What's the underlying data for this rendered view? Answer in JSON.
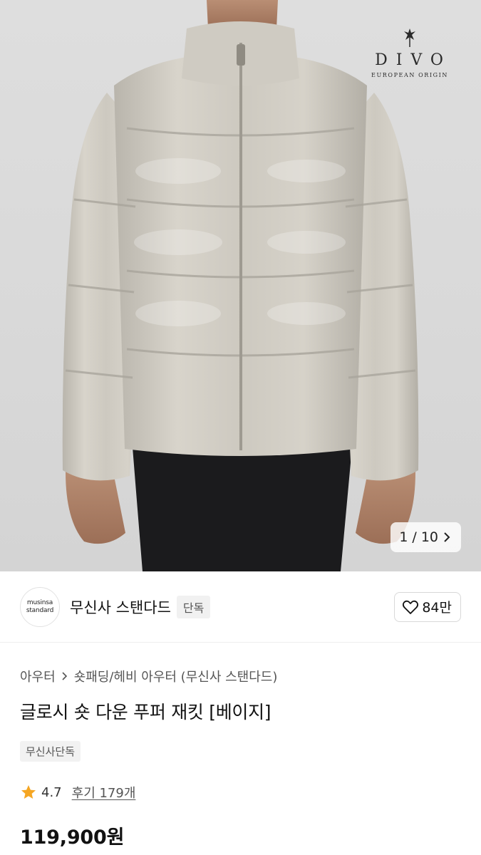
{
  "hero": {
    "photo_subject": "beige glossy puffer jacket worn by model",
    "watermark": {
      "name": "DIVO",
      "subtitle": "EUROPEAN ORIGIN"
    },
    "counter": {
      "current": "1",
      "separator": "/",
      "total": "10"
    },
    "icons": {
      "next": "chevron-right-icon"
    }
  },
  "brand": {
    "avatar_line1": "musinsa",
    "avatar_line2": "standard",
    "name": "무신사 스탠다드",
    "tag": "단독",
    "likes": "84만",
    "icons": {
      "like": "heart-outline-icon"
    }
  },
  "product": {
    "breadcrumb": [
      "아우터",
      "숏패딩/헤비 아우터 (무신사 스탠다드)"
    ],
    "title": "글로시 숏 다운 푸퍼 재킷 [베이지]",
    "badge": "무신사단독",
    "rating": "4.7",
    "reviews": "후기 179개",
    "price": "119,900원",
    "colors": {
      "star": "#f5a623"
    }
  }
}
